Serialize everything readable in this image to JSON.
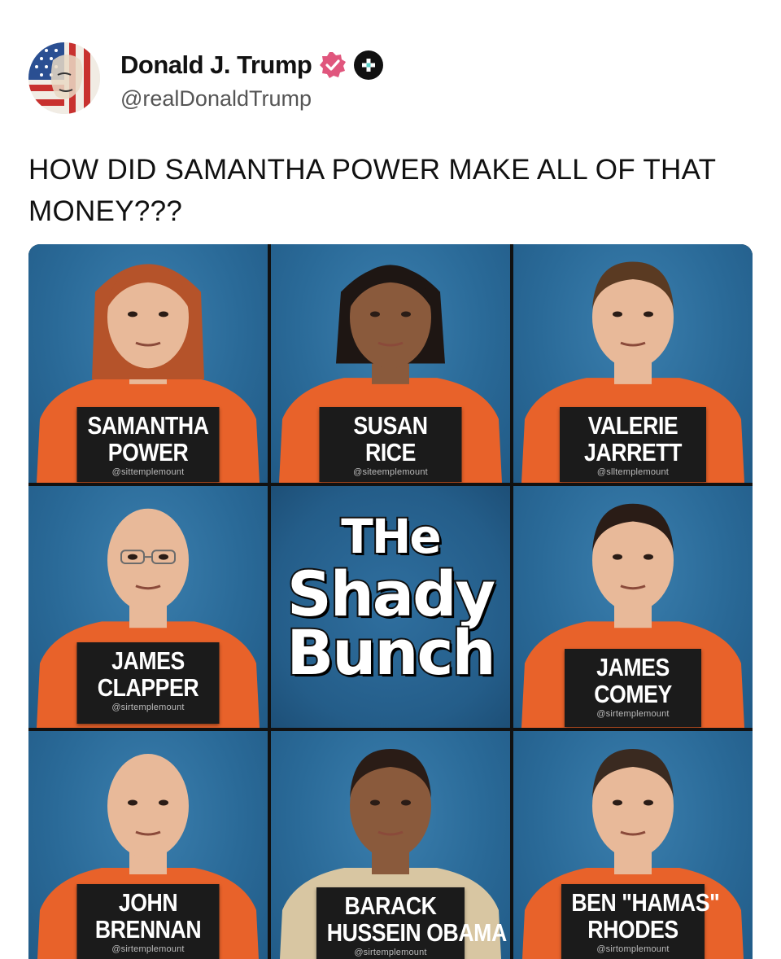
{
  "post": {
    "author": {
      "display_name": "Donald J. Trump",
      "handle": "@realDonaldTrump",
      "verified_icon": "verified-badge-icon",
      "extra_icon": "plus-badge-icon",
      "badge_color": "#e0567d"
    },
    "text": "HOW DID SAMANTHA POWER MAKE ALL OF THAT MONEY???"
  },
  "image": {
    "logo": {
      "line1": "THe",
      "line2": "Shady",
      "line3": "Bunch"
    },
    "cells": [
      {
        "name_line1": "SAMANTHA",
        "name_line2": "POWER",
        "watermark": "@sittemplemount",
        "outfit": "orange"
      },
      {
        "name_line1": "SUSAN",
        "name_line2": "RICE",
        "watermark": "@siteemplemount",
        "outfit": "orange"
      },
      {
        "name_line1": "VALERIE",
        "name_line2": "JARRETT",
        "watermark": "@slltemplemount",
        "outfit": "orange"
      },
      {
        "name_line1": "JAMES",
        "name_line2": "CLAPPER",
        "watermark": "@sirtemplemount",
        "outfit": "orange"
      },
      {
        "name_line1": "JAMES",
        "name_line2": "COMEY",
        "watermark": "@sirtemplemount",
        "outfit": "orange"
      },
      {
        "name_line1": "JOHN",
        "name_line2": "BRENNAN",
        "watermark": "@sirtemplemount",
        "outfit": "orange"
      },
      {
        "name_line1": "BARACK",
        "name_line2": "HUSSEIN OBAMA",
        "watermark": "@sirtemplemount",
        "outfit": "tan"
      },
      {
        "name_line1": "BEN \"HAMAS\"",
        "name_line2": "RHODES",
        "watermark": "@sirtomplemount",
        "outfit": "orange"
      }
    ],
    "colors": {
      "background": "#2a6a98",
      "jumpsuit": "#e8622a",
      "sign": "#1b1b1b"
    }
  }
}
